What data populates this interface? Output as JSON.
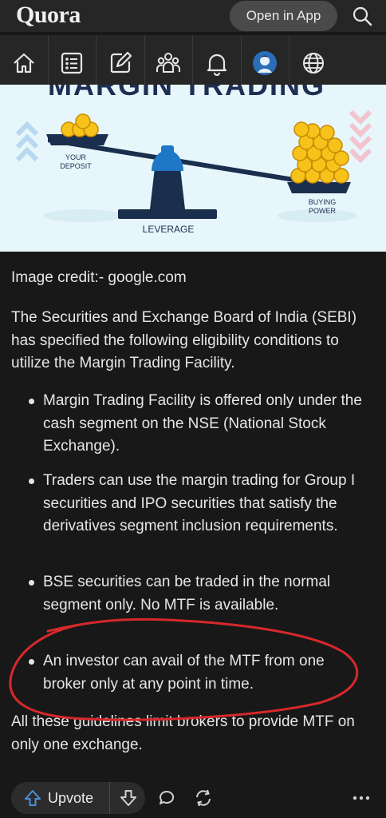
{
  "header": {
    "logo": "Quora",
    "open_app_label": "Open in App"
  },
  "nav": {
    "items": [
      "home-icon",
      "following-icon",
      "answer-icon",
      "spaces-icon",
      "notifications-icon",
      "profile-icon",
      "languages-icon"
    ]
  },
  "illustration": {
    "title": "MARGIN TRADING",
    "label_deposit": "YOUR\nDEPOSIT",
    "label_buying": "BUYING\nPOWER",
    "label_leverage": "LEVERAGE"
  },
  "answer": {
    "image_credit": "Image credit:- google.com",
    "intro": "The Securities and Exchange Board of India (SEBI) has specified the following eligibility conditions to utilize the Margin Trading Facility.",
    "bullets": [
      "Margin Trading Facility is offered only under the cash segment on the NSE (National Stock Exchange).",
      "Traders can use the margin trading for Group I securities and IPO securities that satisfy the derivatives segment inclusion requirements.",
      "BSE securities can be traded in the normal segment only. No MTF is available.",
      "An investor can avail of the MTF from one broker only at any point in time."
    ],
    "conclusion": "All these guidelines limit brokers to provide MTF on only one exchange."
  },
  "actions": {
    "upvote_label": "Upvote"
  },
  "colors": {
    "background": "#181818",
    "bar": "#262626",
    "accent": "#4a90e2",
    "annotation": "#d6282b"
  }
}
